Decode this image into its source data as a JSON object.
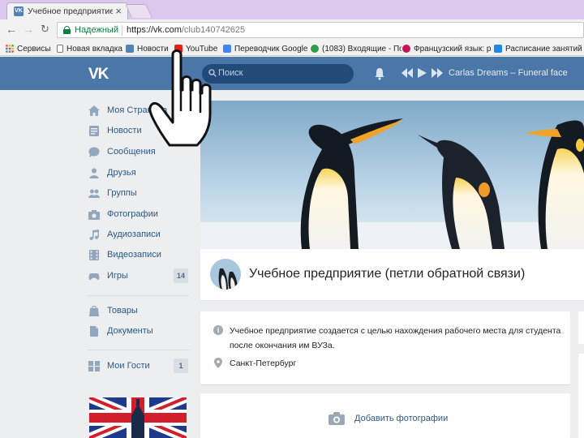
{
  "browser": {
    "tab_title": "Учебное предприятие (",
    "tab_close": "×",
    "tab_favicon_letter": "VK",
    "secure_label": "Надежный",
    "url_host": "https://vk.com",
    "url_path": "/club140742625",
    "bookmarks": [
      {
        "label": "Сервисы",
        "icon": "apps-grid-icon",
        "color": "#e74c3c"
      },
      {
        "label": "Новая вкладка",
        "icon": "page-icon",
        "color": "#ffffff"
      },
      {
        "label": "Новости",
        "icon": "vk-icon",
        "color": "#5181b8"
      },
      {
        "label": "YouTube",
        "icon": "youtube-icon",
        "color": "#e62117"
      },
      {
        "label": "Переводчик Google",
        "icon": "translate-icon",
        "color": "#4285f4"
      },
      {
        "label": "(1083) Входящие - По",
        "icon": "mail-icon",
        "color": "#2e9e4c"
      },
      {
        "label": "Французский язык: р",
        "icon": "flower-icon",
        "color": "#c2185b"
      },
      {
        "label": "Расписание занятий",
        "icon": "schedule-icon",
        "color": "#1e88e5"
      }
    ]
  },
  "vk": {
    "logo": "VK",
    "search_placeholder": "Поиск",
    "now_playing": "Carlas Dreams – Funeral face",
    "brand_color": "#4a76a8"
  },
  "menu": {
    "items": [
      {
        "label": "Моя Страница",
        "icon": "home-icon"
      },
      {
        "label": "Новости",
        "icon": "news-icon"
      },
      {
        "label": "Сообщения",
        "icon": "messages-icon"
      },
      {
        "label": "Друзья",
        "icon": "friend-icon"
      },
      {
        "label": "Группы",
        "icon": "groups-icon"
      },
      {
        "label": "Фотографии",
        "icon": "camera-icon"
      },
      {
        "label": "Аудиозаписи",
        "icon": "music-icon"
      },
      {
        "label": "Видеозаписи",
        "icon": "video-icon"
      },
      {
        "label": "Игры",
        "icon": "games-icon",
        "count": "14"
      },
      {
        "label": "Товары",
        "icon": "goods-icon"
      },
      {
        "label": "Документы",
        "icon": "documents-icon"
      },
      {
        "label": "Мои Гости",
        "icon": "guests-icon",
        "count": "1"
      }
    ]
  },
  "group": {
    "title": "Учебное предприятие (петли обратной связи)",
    "description": "Учебное предприятие создается с целью нахождения рабочего места для студента после окончания им ВУЗа.",
    "city": "Санкт-Петербург",
    "add_photos": "Добавить фотографии"
  }
}
